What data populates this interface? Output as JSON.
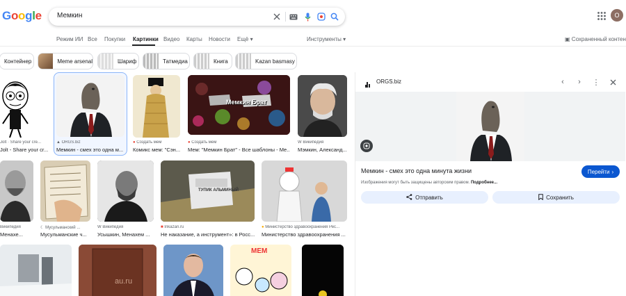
{
  "header": {
    "logo_letters": [
      "G",
      "o",
      "o",
      "g",
      "l",
      "e"
    ],
    "search_query": "Мемкин",
    "avatar_initial": "О",
    "icons": [
      "clear-icon",
      "keyboard-icon",
      "microphone-icon",
      "lens-icon",
      "search-icon",
      "apps-grid-icon"
    ]
  },
  "nav": {
    "tabs": [
      "Режим ИИ",
      "Все",
      "Покупки",
      "Картинки",
      "Видео",
      "Карты",
      "Новости",
      "Ещё"
    ],
    "active_tab": "Картинки",
    "tools": "Инструменты",
    "saved": "Сохраненный контент"
  },
  "chips": [
    "Контейнер",
    "Meme arsenal",
    "Шариф",
    "Татмедиа",
    "Книга",
    "Kazan basmasy"
  ],
  "results": [
    {
      "source": "Jolt · Share your cre...",
      "title": "Jolt - Share your cr..."
    },
    {
      "source": "ORGS.biz",
      "title": "Мемкин - смех это одна м..."
    },
    {
      "source": "Создать мем",
      "title": "Комикс мем: \"Сэн..."
    },
    {
      "source": "Создать мем",
      "title": "Мем: \"Мемкин Брат\" - Все шаблоны - Ме..."
    },
    {
      "source": "Википедия",
      "title": "Мэмкин, Александ..."
    },
    {
      "source": "Википедия",
      "title": "Менахе..."
    },
    {
      "source": "Мусульманский ...",
      "title": "Мусульманские ч..."
    },
    {
      "source": "Википедия",
      "title": "Усышкин, Менахем ..."
    },
    {
      "source": "Inkazan.ru",
      "title": "Не наказание, а инструмент»: в Росс..."
    },
    {
      "source": "Министерство здравоохранения Рес...",
      "title": "Министерство здравоохранения ..."
    }
  ],
  "image_text": {
    "meme_banner": "Мемкин Брат",
    "plate": "ТУПИК АЛЬМИНЫЙ",
    "watermark": "au.ru",
    "comic": "МЕМ"
  },
  "panel": {
    "site": "ORGS.biz",
    "title": "Мемкин - смех это одна минута жизни",
    "visit": "Перейти",
    "copyright": "Изображения могут быть защищены авторским правом.",
    "more": "Подробнее...",
    "share": "Отправить",
    "save": "Сохранить"
  },
  "colors": {
    "blue": "#4285f4",
    "red": "#ea4335",
    "yellow": "#fbbc05",
    "green": "#34a853",
    "primary": "#0b57d0"
  }
}
